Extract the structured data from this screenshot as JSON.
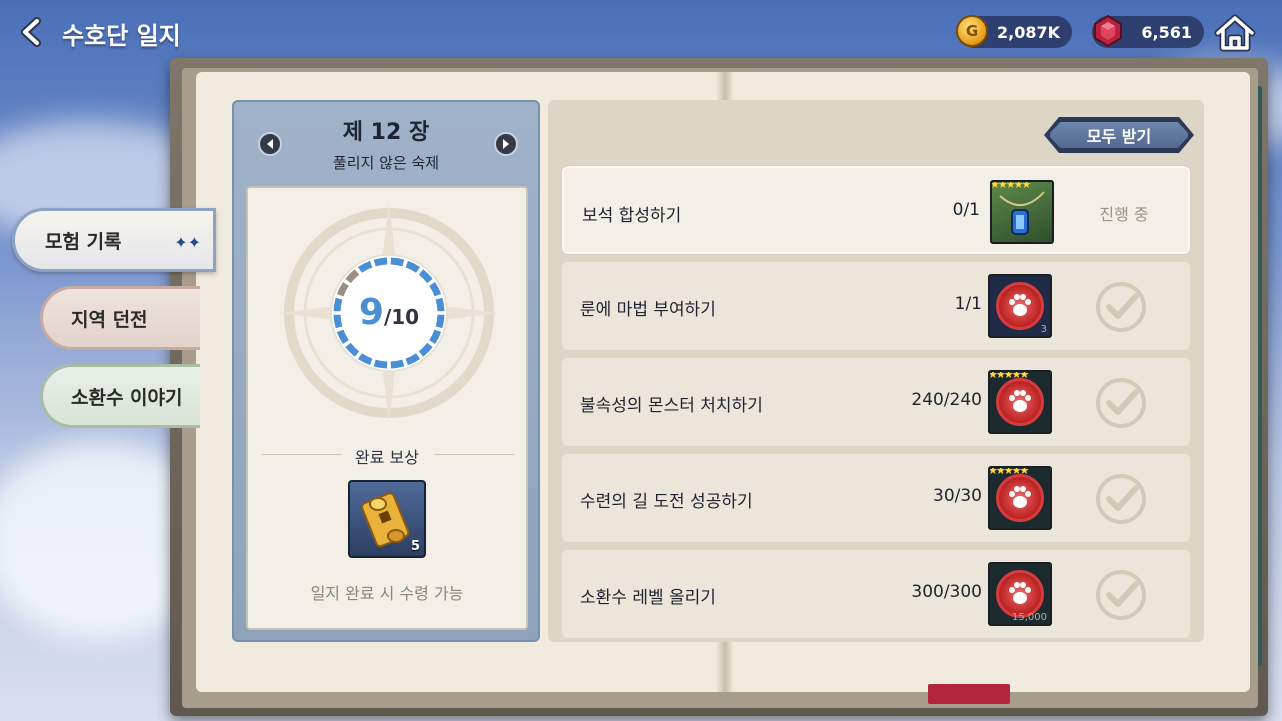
{
  "header": {
    "title": "수호단 일지",
    "gold": "2,087K",
    "gems": "6,561"
  },
  "side_tabs": [
    {
      "label": "모험 기록",
      "active": true
    },
    {
      "label": "지역 던전",
      "active": false
    },
    {
      "label": "소환수 이야기",
      "active": false
    }
  ],
  "chapter": {
    "title": "제 12 장",
    "subtitle": "풀리지 않은 숙제",
    "progress_current": "9",
    "progress_total": "/10",
    "progress_fraction": 0.9,
    "reward_label": "완료 보상",
    "reward_item_icon": "scroll-icon",
    "reward_count": "5",
    "reward_note": "일지 완료 시 수령 가능"
  },
  "quests": {
    "claim_all_label": "모두 받기",
    "items": [
      {
        "name": "보석 합성하기",
        "progress": "0/1",
        "reward_icon": "necklace-icon",
        "stars": 5,
        "reward_count": "",
        "status": "진행 중",
        "done": false
      },
      {
        "name": "룬에 마법 부여하기",
        "progress": "1/1",
        "reward_icon": "paw-medal-icon",
        "stars": 0,
        "reward_count": "3",
        "status": "",
        "done": true
      },
      {
        "name": "불속성의 몬스터 처치하기",
        "progress": "240/240",
        "reward_icon": "paw-medal-icon",
        "stars": 5,
        "reward_count": "",
        "status": "",
        "done": true
      },
      {
        "name": "수련의 길 도전 성공하기",
        "progress": "30/30",
        "reward_icon": "paw-medal-icon",
        "stars": 5,
        "reward_count": "",
        "status": "",
        "done": true
      },
      {
        "name": "소환수 레벨 올리기",
        "progress": "300/300",
        "reward_icon": "paw-medal-icon",
        "stars": 0,
        "reward_count": "15,000",
        "status": "",
        "done": true
      }
    ]
  },
  "colors": {
    "accent_blue": "#4a8fd6",
    "claim_button": "#5f76a0",
    "paw_red": "#d83b3b"
  }
}
